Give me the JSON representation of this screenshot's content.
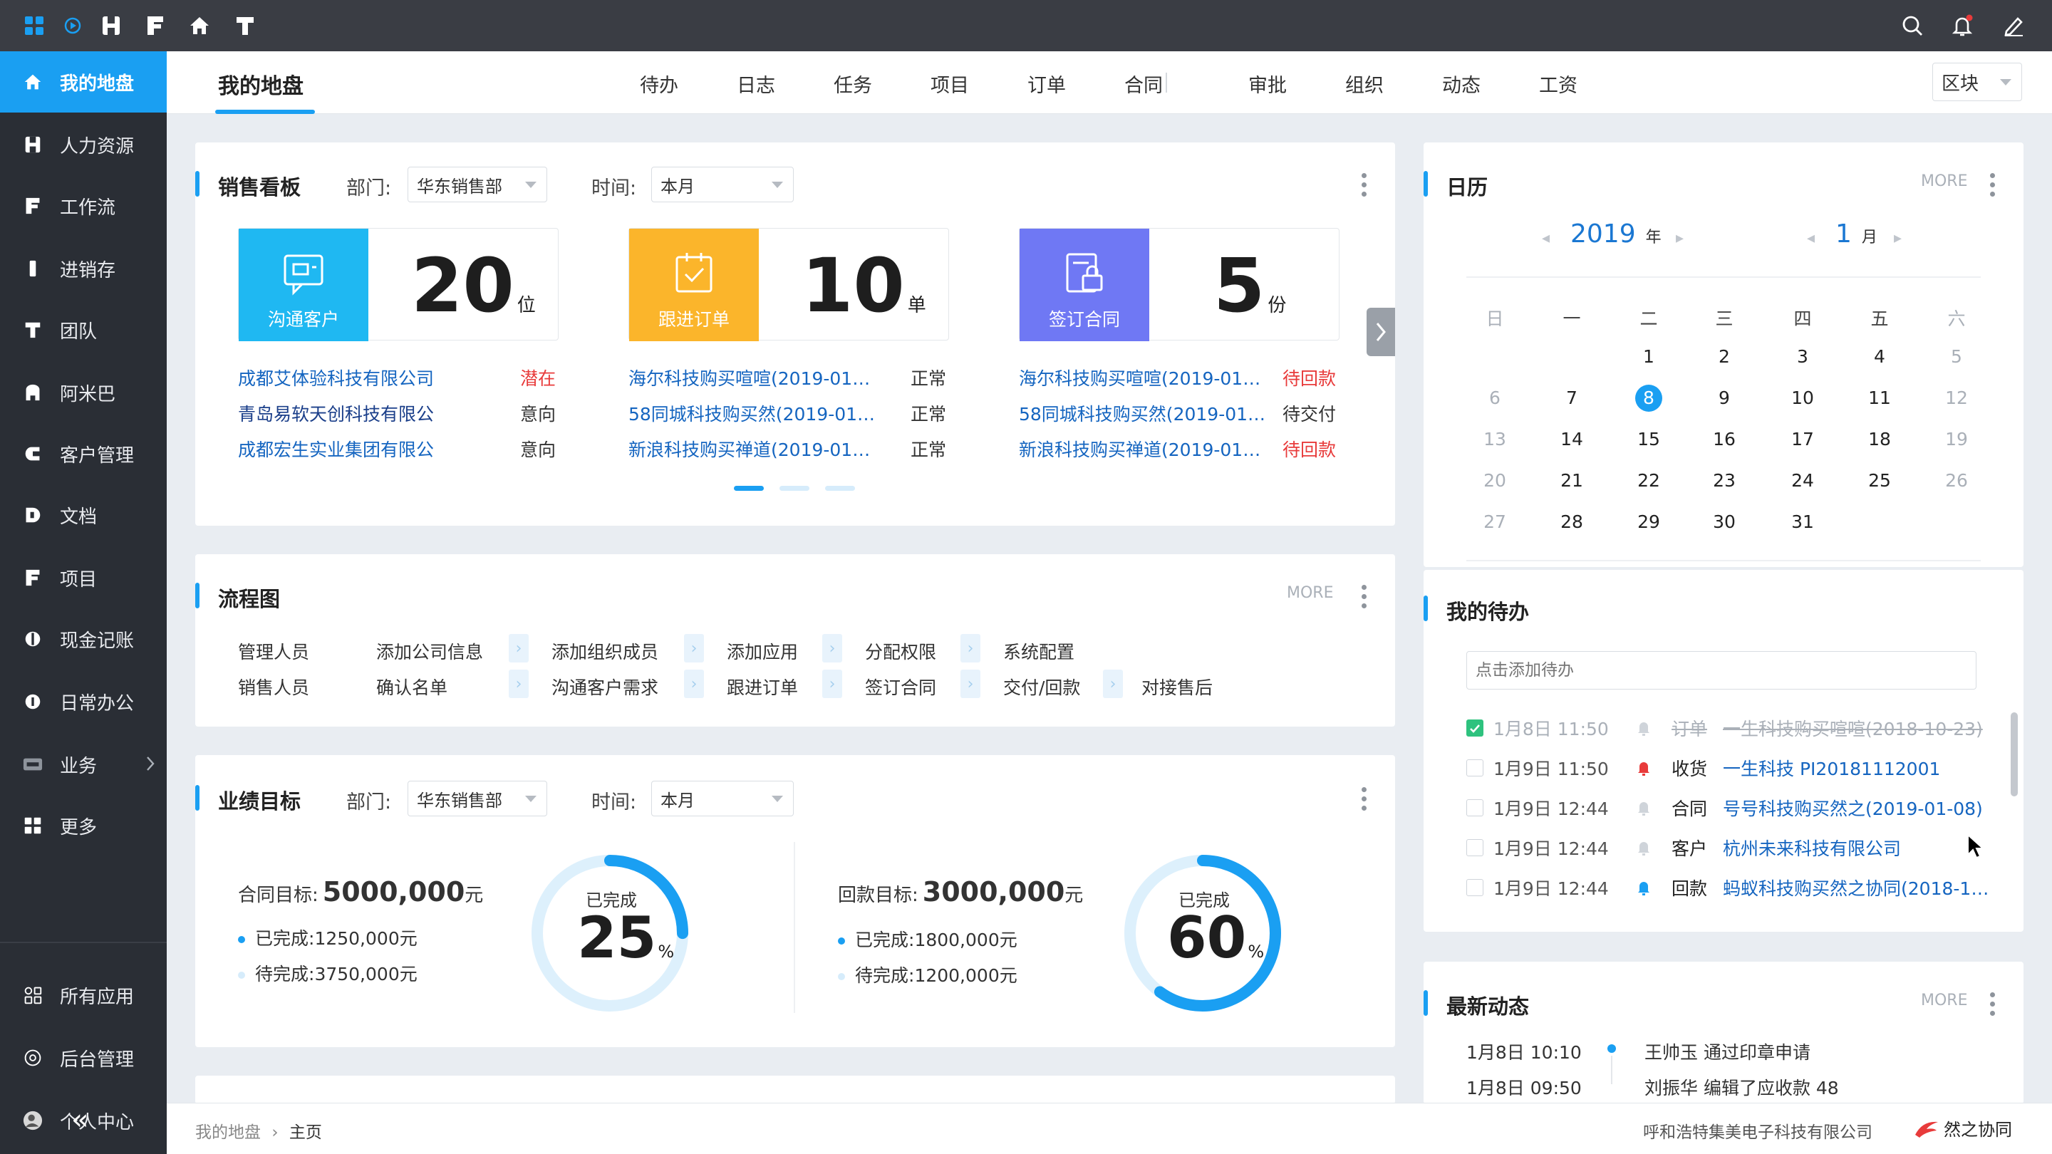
{
  "topbar": {
    "icons": [
      "grid-icon",
      "circle-play-icon",
      "h-icon",
      "f-icon",
      "home-icon",
      "t-icon"
    ],
    "right_icons": [
      "search-icon",
      "bell-icon",
      "pen-icon"
    ]
  },
  "sidebar": {
    "items": [
      {
        "label": "我的地盘",
        "icon": "home-icon",
        "active": true
      },
      {
        "label": "人力资源",
        "icon": "h-icon"
      },
      {
        "label": "工作流",
        "icon": "f-icon"
      },
      {
        "label": "进销存",
        "icon": "bar-icon"
      },
      {
        "label": "团队",
        "icon": "t-icon"
      },
      {
        "label": "阿米巴",
        "icon": "a-icon"
      },
      {
        "label": "客户管理",
        "icon": "c-icon"
      },
      {
        "label": "文档",
        "icon": "d-icon"
      },
      {
        "label": "项目",
        "icon": "f-icon"
      },
      {
        "label": "现金记账",
        "icon": "dollar-icon"
      },
      {
        "label": "日常办公",
        "icon": "i-icon"
      },
      {
        "label": "业务",
        "icon": "business-icon"
      },
      {
        "label": "更多",
        "icon": "grid-icon"
      }
    ],
    "bottom": [
      {
        "label": "所有应用",
        "icon": "apps-icon"
      },
      {
        "label": "后台管理",
        "icon": "settings-icon"
      },
      {
        "label": "个人中心",
        "icon": "avatar-icon"
      }
    ],
    "collapse": "«"
  },
  "header": {
    "title": "我的地盘",
    "tabs": [
      "待办",
      "日志",
      "任务",
      "项目",
      "订单",
      "合同",
      "审批",
      "组织",
      "动态",
      "工资"
    ],
    "block_btn": "区块"
  },
  "sales": {
    "title": "销售看板",
    "dept_label": "部门:",
    "dept_value": "华东销售部",
    "time_label": "时间:",
    "time_value": "本月",
    "stats": [
      {
        "label": "沟通客户",
        "num": "20",
        "unit": "位",
        "color": "#1fb8f2",
        "rows": [
          [
            "成都艾体验科技有限公司",
            "潜在"
          ],
          [
            "青岛易软天创科技有限公",
            "意向"
          ],
          [
            "成都宏生实业集团有限公",
            "意向"
          ]
        ]
      },
      {
        "label": "跟进订单",
        "num": "10",
        "unit": "单",
        "color": "#fbb52b",
        "rows": [
          [
            "海尔科技购买喧喧(2019-01…",
            "正常"
          ],
          [
            "58同城科技购买然(2019-01…",
            "正常"
          ],
          [
            "新浪科技购买禅道(2019-01…",
            "正常"
          ]
        ]
      },
      {
        "label": "签订合同",
        "num": "5",
        "unit": "份",
        "color": "#6f78f4",
        "rows": [
          [
            "海尔科技购买喧喧(2019-01…",
            "待回款"
          ],
          [
            "58同城科技购买然(2019-01…",
            "待交付"
          ],
          [
            "新浪科技购买禅道(2019-01…",
            "待回款"
          ]
        ]
      }
    ]
  },
  "flow": {
    "title": "流程图",
    "more": "MORE",
    "rows": [
      {
        "role": "管理人员",
        "steps": [
          "添加公司信息",
          "添加组织成员",
          "添加应用",
          "分配权限",
          "系统配置"
        ]
      },
      {
        "role": "销售人员",
        "steps": [
          "确认名单",
          "沟通客户需求",
          "跟进订单",
          "签订合同",
          "交付/回款",
          "对接售后"
        ]
      }
    ]
  },
  "goals": {
    "title": "业绩目标",
    "dept_label": "部门:",
    "dept_value": "华东销售部",
    "time_label": "时间:",
    "time_value": "本月",
    "items": [
      {
        "target_label": "合同目标:",
        "target": "5000,000",
        "unit": "元",
        "done_label": "已完成:",
        "done": "1250,000元",
        "todo_label": "待完成:",
        "todo": "3750,000元",
        "ring_label": "已完成",
        "percent": 25,
        "pct_sign": "%"
      },
      {
        "target_label": "回款目标:",
        "target": "3000,000",
        "unit": "元",
        "done_label": "已完成:",
        "done": "1800,000元",
        "todo_label": "待完成:",
        "todo": "1200,000元",
        "ring_label": "已完成",
        "percent": 60,
        "pct_sign": "%"
      }
    ]
  },
  "calendar": {
    "title": "日历",
    "more": "MORE",
    "year": "2019",
    "year_unit": "年",
    "month": "1",
    "month_unit": "月",
    "weekdays": [
      "日",
      "一",
      "二",
      "三",
      "四",
      "五",
      "六"
    ],
    "weeks": [
      [
        "",
        "",
        "1",
        "2",
        "3",
        "4",
        "5"
      ],
      [
        "6",
        "7",
        "8",
        "9",
        "10",
        "11",
        "12"
      ],
      [
        "13",
        "14",
        "15",
        "16",
        "17",
        "18",
        "19"
      ],
      [
        "20",
        "21",
        "22",
        "23",
        "24",
        "25",
        "26"
      ],
      [
        "27",
        "28",
        "29",
        "30",
        "31",
        "",
        ""
      ]
    ],
    "today": "8"
  },
  "todo": {
    "title": "我的待办",
    "placeholder": "点击添加待办",
    "items": [
      {
        "time": "1月8日 11:50",
        "type": "订单",
        "text": "一生科技购买喧喧(2018-10-23)",
        "done": true,
        "bell": "#cfd4da"
      },
      {
        "time": "1月9日 11:50",
        "type": "收货",
        "text": "一生科技 PI20181112001",
        "done": false,
        "bell": "#e83b3b"
      },
      {
        "time": "1月9日 12:44",
        "type": "合同",
        "text": "号号科技购买然之(2019-01-08)",
        "done": false,
        "bell": "#cfd4da"
      },
      {
        "time": "1月9日 12:44",
        "type": "客户",
        "text": "杭州未来科技有限公司",
        "done": false,
        "bell": "#cfd4da"
      },
      {
        "time": "1月9日 12:44",
        "type": "回款",
        "text": "蚂蚁科技购买然之协同(2018-1…",
        "done": false,
        "bell": "#1a9ff2"
      }
    ]
  },
  "news": {
    "title": "最新动态",
    "more": "MORE",
    "items": [
      {
        "time": "1月8日 10:10",
        "text": "王帅玉 通过印章申请"
      },
      {
        "time": "1月8日 09:50",
        "text": "刘振华 编辑了应收款 48"
      }
    ]
  },
  "footer": {
    "breadcrumb": [
      "我的地盘",
      "主页"
    ],
    "company": "呼和浩特集美电子科技有限公司",
    "brand": "然之协同"
  }
}
